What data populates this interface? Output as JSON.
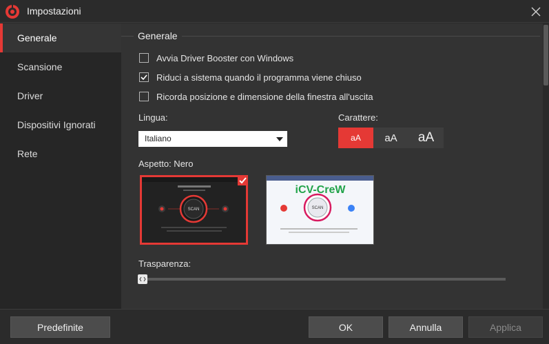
{
  "window": {
    "title": "Impostazioni"
  },
  "sidebar": {
    "items": [
      {
        "label": "Generale",
        "active": true
      },
      {
        "label": "Scansione",
        "active": false
      },
      {
        "label": "Driver",
        "active": false
      },
      {
        "label": "Dispositivi Ignorati",
        "active": false
      },
      {
        "label": "Rete",
        "active": false
      }
    ]
  },
  "general": {
    "section_title": "Generale",
    "options": [
      {
        "label": "Avvia Driver Booster con Windows",
        "checked": false
      },
      {
        "label": "Riduci a sistema quando il programma viene chiuso",
        "checked": true
      },
      {
        "label": "Ricorda posizione e dimensione della finestra all'uscita",
        "checked": false
      }
    ],
    "language": {
      "label": "Lingua:",
      "value": "Italiano"
    },
    "font": {
      "label": "Carattere:",
      "options": [
        "aA",
        "aA",
        "aA"
      ],
      "selected_index": 0
    },
    "appearance": {
      "label": "Aspetto: Nero",
      "themes": [
        {
          "name": "Nero",
          "selected": true,
          "scan_label": "SCAN"
        },
        {
          "name": "Bianco",
          "selected": false,
          "scan_label": "SCAN",
          "watermark": "iCV-CreW"
        }
      ]
    },
    "transparency": {
      "label": "Trasparenza:",
      "value": 0
    }
  },
  "footer": {
    "defaults_label": "Predefinite",
    "ok_label": "OK",
    "cancel_label": "Annulla",
    "apply_label": "Applica"
  },
  "colors": {
    "accent": "#e53935",
    "background": "#333333",
    "sidebar": "#262626"
  }
}
